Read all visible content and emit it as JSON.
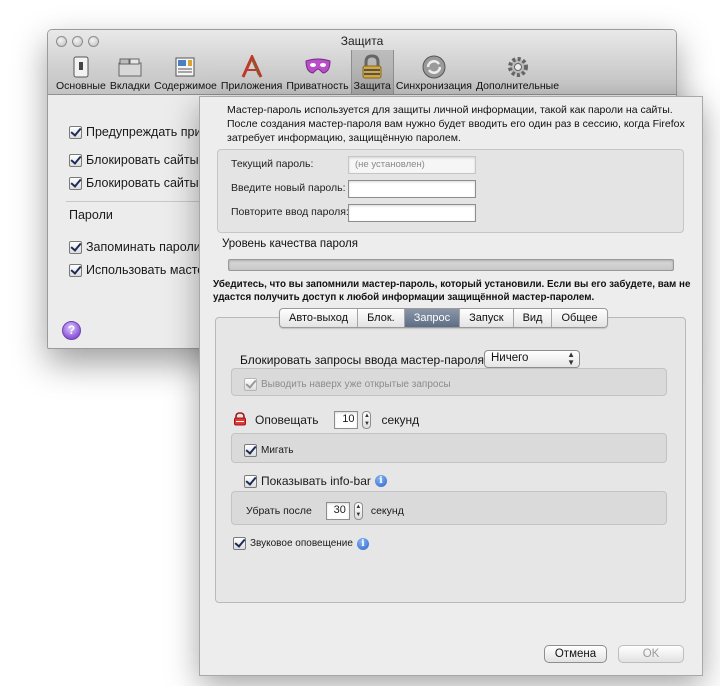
{
  "background_window": {
    "title": "Защита",
    "toolbar": [
      {
        "label": "Основные",
        "icon": "switch-icon"
      },
      {
        "label": "Вкладки",
        "icon": "tabs-icon"
      },
      {
        "label": "Содержимое",
        "icon": "content-icon"
      },
      {
        "label": "Приложения",
        "icon": "applications-icon"
      },
      {
        "label": "Приватность",
        "icon": "mask-icon"
      },
      {
        "label": "Защита",
        "icon": "lock-icon"
      },
      {
        "label": "Синхронизация",
        "icon": "sync-icon"
      },
      {
        "label": "Дополнительные",
        "icon": "gear-icon"
      }
    ],
    "active_toolbar_item": "Защита",
    "checks": [
      {
        "label": "Предупреждать при п",
        "checked": true
      },
      {
        "label": "Блокировать сайты, п",
        "checked": true
      },
      {
        "label": "Блокировать сайты, п",
        "checked": true
      }
    ],
    "passwords_section": "Пароли",
    "password_checks": [
      {
        "label": "Запоминать пароли д",
        "checked": true
      },
      {
        "label": "Использовать мастер-",
        "checked": true
      }
    ],
    "help": "?"
  },
  "dialog": {
    "intro": "Мастер-пароль используется для защиты личной информации, такой как пароли на сайты. После создания мастер-пароля вам нужно будет вводить его один раз в сессию, когда Firefox затребует информацию, защищённую паролем.",
    "current_password_label": "Текущий пароль:",
    "current_password_placeholder": "(не установлен)",
    "new_password_label": "Введите новый пароль:",
    "new_password_value": "",
    "repeat_password_label": "Повторите ввод пароля:",
    "repeat_password_value": "",
    "quality_label": "Уровень качества пароля",
    "quality_level": 0,
    "warning": "Убедитесь, что вы запомнили мастер-пароль, который установили. Если вы его забудете, вам не удастся получить доступ к любой информации защищённой мастер-паролем.",
    "tabs": [
      "Авто-выход",
      "Блок.",
      "Запрос",
      "Запуск",
      "Вид",
      "Общее"
    ],
    "active_tab": "Запрос",
    "prompt_tab": {
      "block_label": "Блокировать запросы ввода мастер-пароля:",
      "block_select_value": "Ничего",
      "bring_front_label": "Выводить наверх уже открытые запросы",
      "bring_front_checked": true,
      "notify_label": "Оповещать",
      "notify_seconds": "10",
      "seconds_label": "секунд",
      "blink_label": "Мигать",
      "blink_checked": true,
      "infobar_label": "Показывать info-bar",
      "infobar_checked": true,
      "remove_after_label": "Убрать после",
      "remove_after_seconds": "30",
      "remove_seconds_label": "секунд",
      "sound_label": "Звуковое оповещение",
      "sound_checked": true
    },
    "cancel_label": "Отмена",
    "ok_label": "OK"
  },
  "colors": {
    "active_tab": "#5d6d85",
    "help_button": "#8a55d6",
    "info_icon": "#2a62c8"
  }
}
